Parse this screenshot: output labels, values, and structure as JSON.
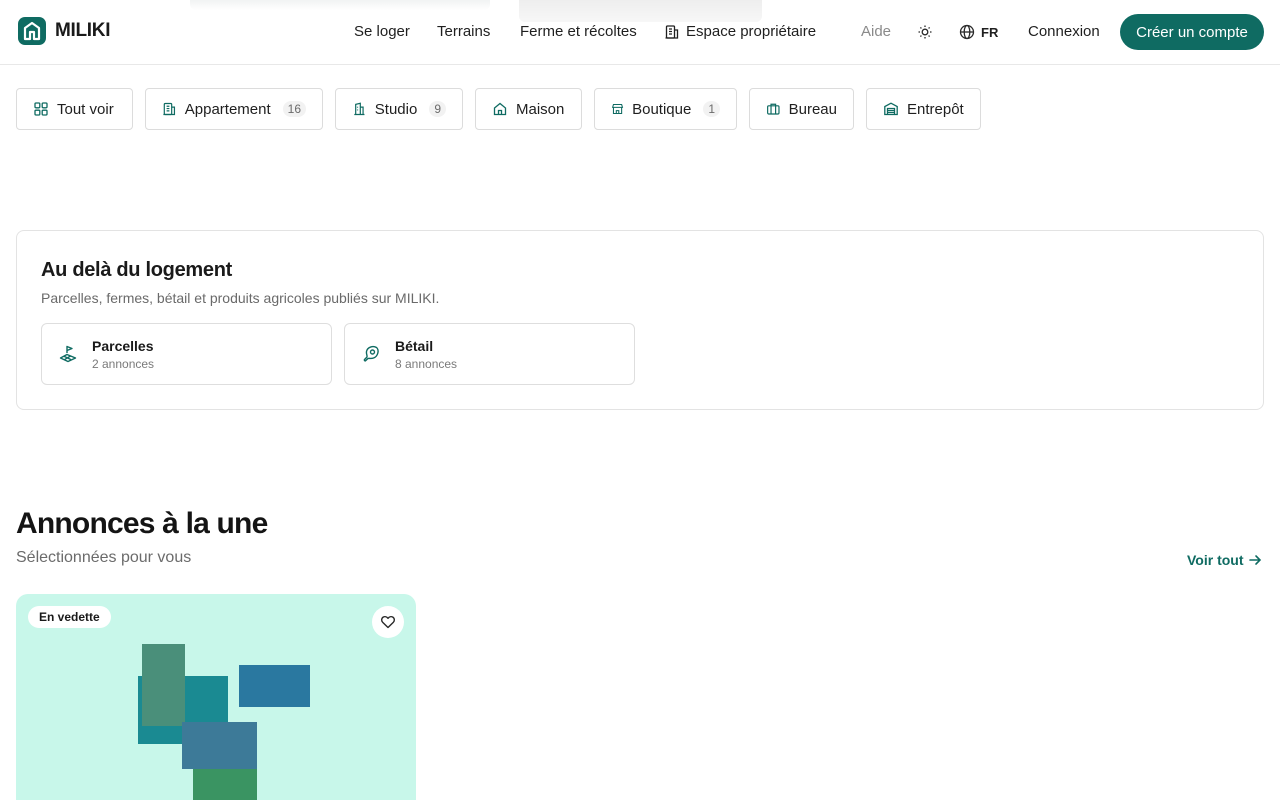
{
  "brand": {
    "name": "MILIKI",
    "accent": "#0f6b62"
  },
  "nav": {
    "items": [
      "Se loger",
      "Terrains",
      "Ferme et récoltes"
    ],
    "owner_space": "Espace propriétaire",
    "help": "Aide",
    "language": "FR",
    "login": "Connexion",
    "signup": "Créer un compte"
  },
  "filters": [
    {
      "label": "Tout voir",
      "icon": "grid-icon"
    },
    {
      "label": "Appartement",
      "count": "16",
      "icon": "building-icon"
    },
    {
      "label": "Studio",
      "count": "9",
      "icon": "tower-icon"
    },
    {
      "label": "Maison",
      "icon": "home-icon"
    },
    {
      "label": "Boutique",
      "count": "1",
      "icon": "store-icon"
    },
    {
      "label": "Bureau",
      "icon": "briefcase-icon"
    },
    {
      "label": "Entrepôt",
      "icon": "warehouse-icon"
    }
  ],
  "beyond": {
    "title": "Au delà du logement",
    "subtitle": "Parcelles, fermes, bétail et produits agricoles publiés sur MILIKI.",
    "categories": [
      {
        "name": "Parcelles",
        "count": "2 annonces",
        "icon": "land-plot-icon"
      },
      {
        "name": "Bétail",
        "count": "8 annonces",
        "icon": "beef-icon"
      }
    ]
  },
  "featured": {
    "title": "Annonces à la une",
    "subtitle": "Sélectionnées pour vous",
    "see_all": "Voir tout",
    "listing": {
      "badge": "En vedette"
    }
  }
}
